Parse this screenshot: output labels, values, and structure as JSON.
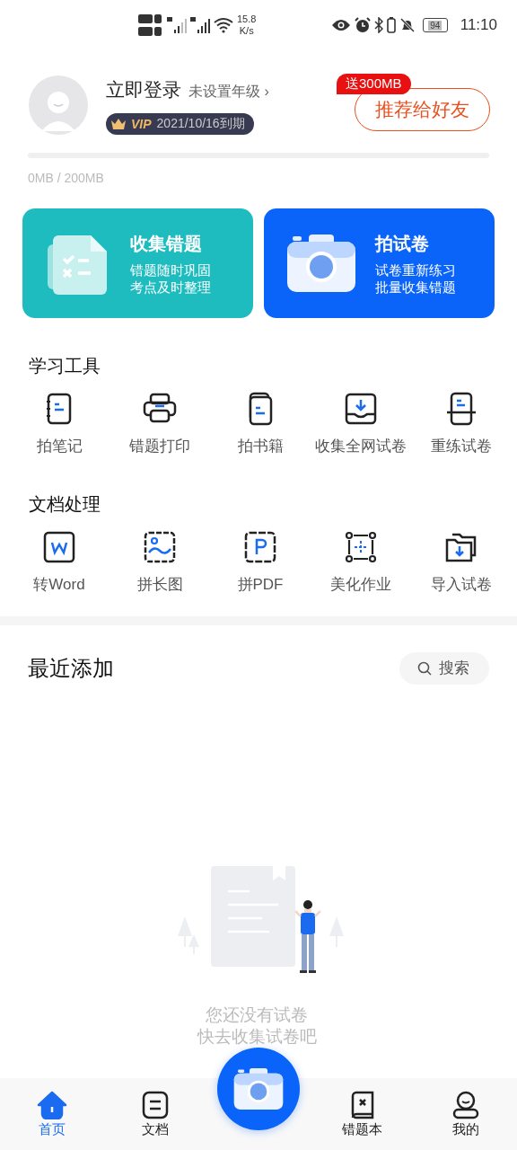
{
  "status_bar": {
    "speed": "15.8",
    "speed_unit": "K/s",
    "battery": "94",
    "time": "11:10"
  },
  "profile": {
    "name": "立即登录",
    "grade": "未设置年级",
    "grade_arrow": "›",
    "vip_label": "VIP",
    "vip_expiry": "2021/10/16到期",
    "refer_badge": "送300MB",
    "refer_button": "推荐给好友"
  },
  "storage": {
    "level": 0,
    "reading": "0MB / 200MB"
  },
  "feature_cards": [
    {
      "title": "收集错题",
      "lines": [
        "错题随时巩固",
        "考点及时整理"
      ],
      "color": "#1fbcbf"
    },
    {
      "title": "拍试卷",
      "lines": [
        "试卷重新练习",
        "批量收集错题"
      ],
      "color": "#0a64fa"
    }
  ],
  "sections": [
    {
      "title": "学习工具",
      "tools": [
        "拍笔记",
        "错题打印",
        "拍书籍",
        "收集全网试卷",
        "重练试卷"
      ]
    },
    {
      "title": "文档处理",
      "tools": [
        "转Word",
        "拼长图",
        "拼PDF",
        "美化作业",
        "导入试卷"
      ]
    }
  ],
  "recent": {
    "title": "最近添加",
    "search_placeholder": "搜索",
    "empty_lines": [
      "您还没有试卷",
      "快去收集试卷吧"
    ]
  },
  "bottom_nav": [
    {
      "label": "首页",
      "selected": true
    },
    {
      "label": "文档",
      "selected": false
    },
    {
      "label": "错题本",
      "selected": false
    },
    {
      "label": "我的",
      "selected": false
    }
  ]
}
